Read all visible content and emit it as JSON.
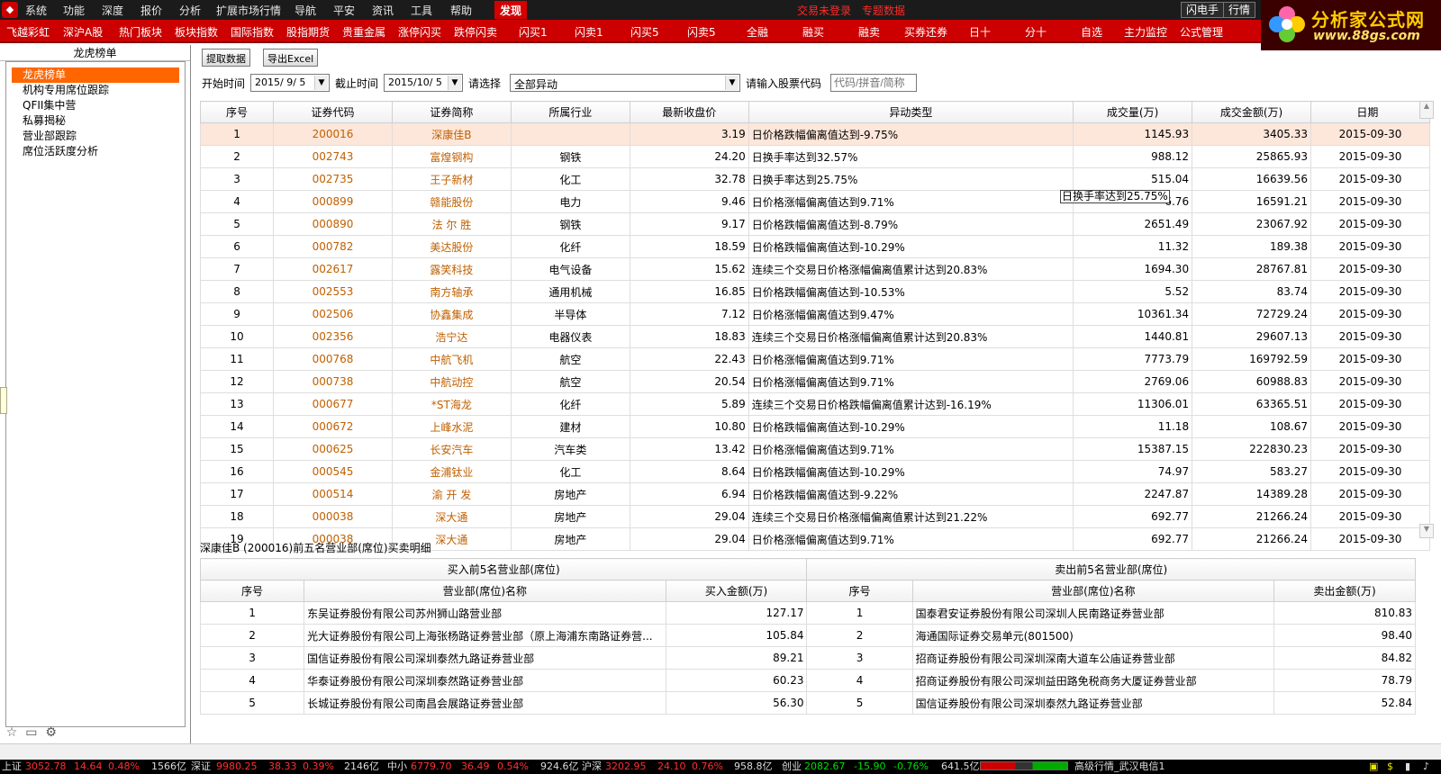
{
  "menubar": {
    "items": [
      "系统",
      "功能",
      "深度",
      "报价",
      "分析",
      "扩展市场行情",
      "导航",
      "平安",
      "资讯",
      "工具",
      "帮助"
    ],
    "active": "发现",
    "status1": "交易未登录",
    "status2": "专题数据",
    "right_buttons": [
      "闪电手",
      "行情"
    ]
  },
  "toolbar": {
    "items": [
      "飞越彩虹",
      "深沪A股",
      "热门板块",
      "板块指数",
      "国际指数",
      "股指期货",
      "贵重金属",
      "涨停闪买",
      "跌停闪卖",
      "闪买1",
      "闪卖1",
      "闪买5",
      "闪卖5",
      "全融",
      "融买",
      "融卖",
      "买券还券",
      "日十",
      "分十",
      "自选",
      "主力监控",
      "公式管理"
    ]
  },
  "brand": {
    "name": "分析家公式网",
    "url": "www.88gs.com"
  },
  "sidebar": {
    "title": "龙虎榜单",
    "items": [
      {
        "label": "龙虎榜单",
        "selected": true
      },
      {
        "label": "机构专用席位跟踪"
      },
      {
        "label": "QFII集中营"
      },
      {
        "label": "私募揭秘"
      },
      {
        "label": "营业部跟踪"
      },
      {
        "label": "席位活跃度分析"
      }
    ],
    "icons": [
      "star-icon",
      "folder-icon",
      "gear-icon"
    ]
  },
  "controls": {
    "fetch_label": "提取数据",
    "export_label": "导出Excel",
    "start_label": "开始时间",
    "start_value": "2015/ 9/ 5",
    "end_label": "截止时间",
    "end_value": "2015/10/ 5",
    "select_label": "请选择",
    "select_value": "全部异动",
    "code_label": "请输入股票代码",
    "code_placeholder": "代码/拼音/简称"
  },
  "main_table": {
    "headers": [
      "序号",
      "证券代码",
      "证券简称",
      "所属行业",
      "最新收盘价",
      "异动类型",
      "成交量(万)",
      "成交金额(万)",
      "日期"
    ],
    "rows": [
      [
        "1",
        "200016",
        "深康佳B",
        "",
        "3.19",
        "日价格跌幅偏离值达到-9.75%",
        "1145.93",
        "3405.33",
        "2015-09-30"
      ],
      [
        "2",
        "002743",
        "富煌钢构",
        "钢铁",
        "24.20",
        "日换手率达到32.57%",
        "988.12",
        "25865.93",
        "2015-09-30"
      ],
      [
        "3",
        "002735",
        "王子新材",
        "化工",
        "32.78",
        "日换手率达到25.75%",
        "515.04",
        "16639.56",
        "2015-09-30"
      ],
      [
        "4",
        "000899",
        "赣能股份",
        "电力",
        "9.46",
        "日价格涨幅偏离值达到9.71%",
        "6.76",
        "16591.21",
        "2015-09-30"
      ],
      [
        "5",
        "000890",
        "法 尔 胜",
        "钢铁",
        "9.17",
        "日价格跌幅偏离值达到-8.79%",
        "2651.49",
        "23067.92",
        "2015-09-30"
      ],
      [
        "6",
        "000782",
        "美达股份",
        "化纤",
        "18.59",
        "日价格跌幅偏离值达到-10.29%",
        "11.32",
        "189.38",
        "2015-09-30"
      ],
      [
        "7",
        "002617",
        "露笑科技",
        "电气设备",
        "15.62",
        "连续三个交易日价格涨幅偏离值累计达到20.83%",
        "1694.30",
        "28767.81",
        "2015-09-30"
      ],
      [
        "8",
        "002553",
        "南方轴承",
        "通用机械",
        "16.85",
        "日价格跌幅偏离值达到-10.53%",
        "5.52",
        "83.74",
        "2015-09-30"
      ],
      [
        "9",
        "002506",
        "协鑫集成",
        "半导体",
        "7.12",
        "日价格涨幅偏离值达到9.47%",
        "10361.34",
        "72729.24",
        "2015-09-30"
      ],
      [
        "10",
        "002356",
        "浩宁达",
        "电器仪表",
        "18.83",
        "连续三个交易日价格涨幅偏离值累计达到20.83%",
        "1440.81",
        "29607.13",
        "2015-09-30"
      ],
      [
        "11",
        "000768",
        "中航飞机",
        "航空",
        "22.43",
        "日价格涨幅偏离值达到9.71%",
        "7773.79",
        "169792.59",
        "2015-09-30"
      ],
      [
        "12",
        "000738",
        "中航动控",
        "航空",
        "20.54",
        "日价格涨幅偏离值达到9.71%",
        "2769.06",
        "60988.83",
        "2015-09-30"
      ],
      [
        "13",
        "000677",
        "*ST海龙",
        "化纤",
        "5.89",
        "连续三个交易日价格跌幅偏离值累计达到-16.19%",
        "11306.01",
        "63365.51",
        "2015-09-30"
      ],
      [
        "14",
        "000672",
        "上峰水泥",
        "建材",
        "10.80",
        "日价格跌幅偏离值达到-10.29%",
        "11.18",
        "108.67",
        "2015-09-30"
      ],
      [
        "15",
        "000625",
        "长安汽车",
        "汽车类",
        "13.42",
        "日价格涨幅偏离值达到9.71%",
        "15387.15",
        "222830.23",
        "2015-09-30"
      ],
      [
        "16",
        "000545",
        "金浦钛业",
        "化工",
        "8.64",
        "日价格跌幅偏离值达到-10.29%",
        "74.97",
        "583.27",
        "2015-09-30"
      ],
      [
        "17",
        "000514",
        "渝 开 发",
        "房地产",
        "6.94",
        "日价格跌幅偏离值达到-9.22%",
        "2247.87",
        "14389.28",
        "2015-09-30"
      ],
      [
        "18",
        "000038",
        "深大通",
        "房地产",
        "29.04",
        "连续三个交易日价格涨幅偏离值累计达到21.22%",
        "692.77",
        "21266.24",
        "2015-09-30"
      ],
      [
        "19",
        "000038",
        "深大通",
        "房地产",
        "29.04",
        "日价格涨幅偏离值达到9.71%",
        "692.77",
        "21266.24",
        "2015-09-30"
      ]
    ],
    "tooltip": "日换手率达到25.75%"
  },
  "detail": {
    "title": "深康佳B (200016)前五名营业部(席位)买卖明细",
    "buy_group": "买入前5名营业部(席位)",
    "sell_group": "卖出前5名营业部(席位)",
    "buy_headers": [
      "序号",
      "营业部(席位)名称",
      "买入金额(万)"
    ],
    "sell_headers": [
      "序号",
      "营业部(席位)名称",
      "卖出金额(万)"
    ],
    "buy_rows": [
      [
        "1",
        "东吴证券股份有限公司苏州狮山路营业部",
        "127.17"
      ],
      [
        "2",
        "光大证券股份有限公司上海张杨路证券营业部（原上海浦东南路证券营...",
        "105.84"
      ],
      [
        "3",
        "国信证券股份有限公司深圳泰然九路证券营业部",
        "89.21"
      ],
      [
        "4",
        "华泰证券股份有限公司深圳泰然路证券营业部",
        "60.23"
      ],
      [
        "5",
        "长城证券股份有限公司南昌会展路证券营业部",
        "56.30"
      ]
    ],
    "sell_rows": [
      [
        "1",
        "国泰君安证券股份有限公司深圳人民南路证券营业部",
        "810.83"
      ],
      [
        "2",
        "海通国际证券交易单元(801500)",
        "98.40"
      ],
      [
        "3",
        "招商证券股份有限公司深圳深南大道车公庙证券营业部",
        "84.82"
      ],
      [
        "4",
        "招商证券股份有限公司深圳益田路免税商务大厦证券营业部",
        "78.79"
      ],
      [
        "5",
        "国信证券股份有限公司深圳泰然九路证券营业部",
        "52.84"
      ]
    ]
  },
  "statusbar": {
    "sh_label": "上证",
    "sh_value": "3052.78",
    "sh_chg": "14.64",
    "sh_pct": "0.48%",
    "sh_amt": "1566亿",
    "sz_label": "深证",
    "sz_value": "9980.25",
    "sz_chg": "38.33",
    "sz_pct": "0.39%",
    "sz_amt": "2146亿",
    "zx_label": "中小",
    "zx_value": "6779.70",
    "zx_chg": "36.49",
    "zx_pct": "0.54%",
    "zx_amt": "924.6亿",
    "hs_label": "沪深",
    "hs_value": "3202.95",
    "hs_chg": "24.10",
    "hs_pct": "0.76%",
    "hs_amt": "958.8亿",
    "cy_label": "创业",
    "cy_value": "2082.67",
    "cy_chg": "-15.90",
    "cy_pct": "-0.76%",
    "cy_amt": "641.5亿",
    "server": "高级行情_武汉电信1"
  }
}
